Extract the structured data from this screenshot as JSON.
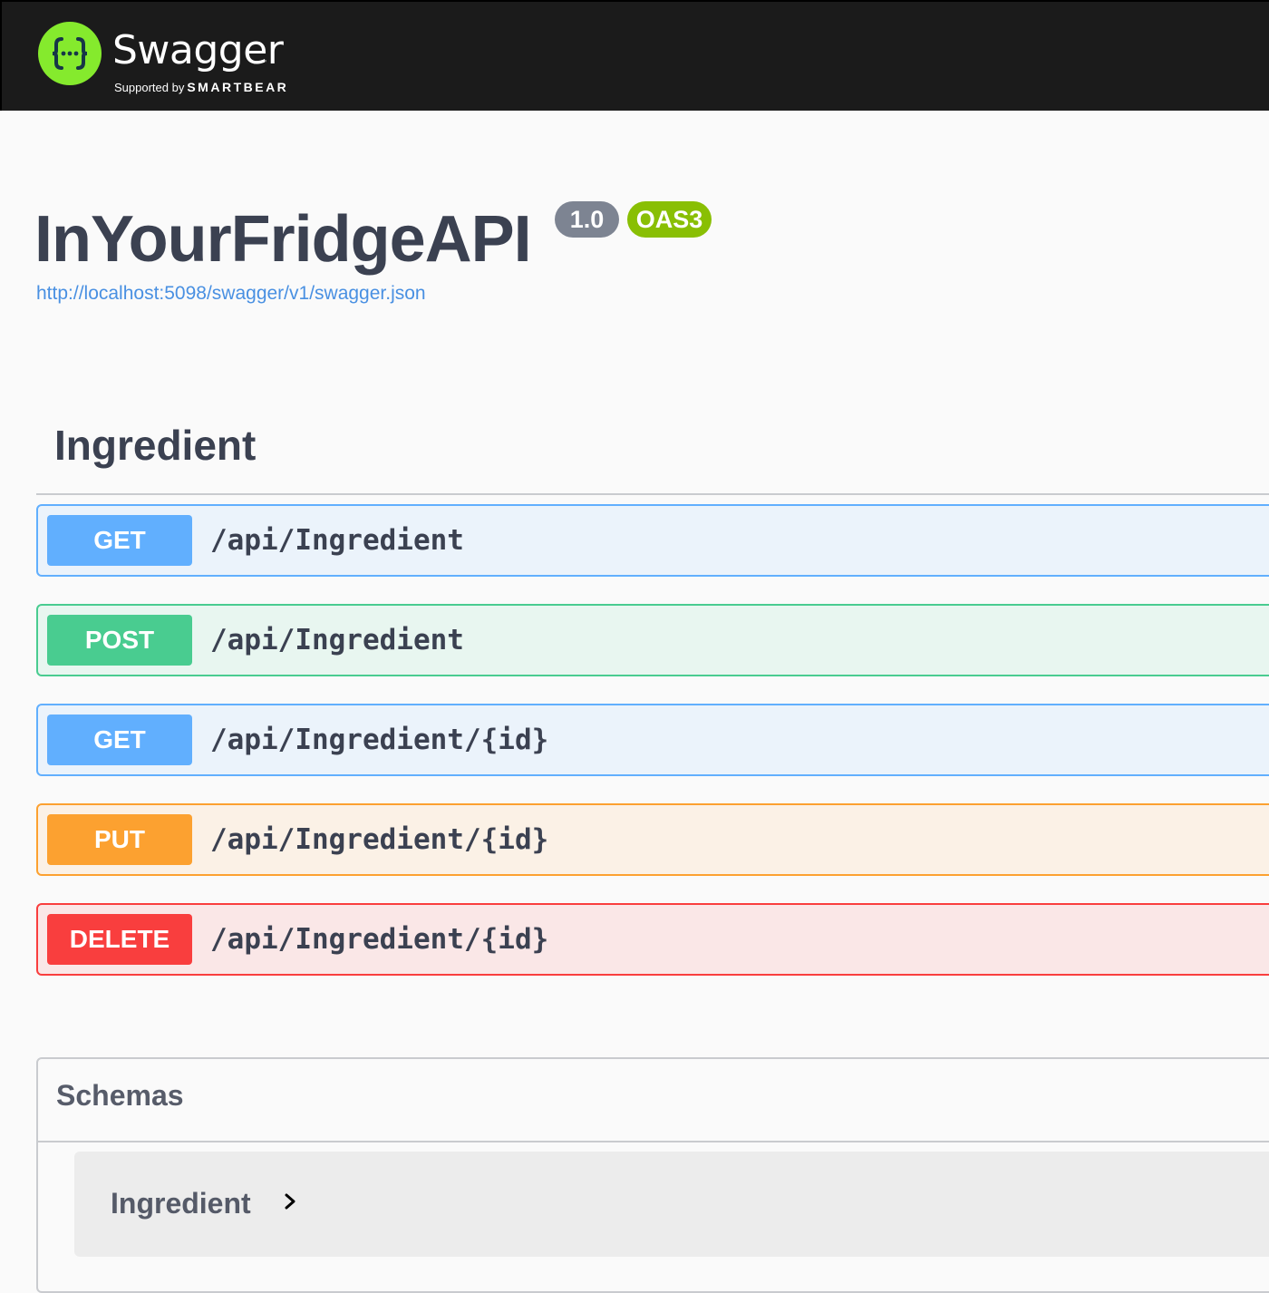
{
  "topbar": {
    "logo_title": "Swagger",
    "logo_tm": "™",
    "supported_by": "Supported by",
    "brand": "SMARTBEAR",
    "logo_icon": "swagger-braces-icon",
    "colors": {
      "background": "#1b1b1b",
      "logo_green": "#85ea2d"
    }
  },
  "info": {
    "title": "InYourFridgeAPI",
    "version": "1.0",
    "oas_badge": "OAS3",
    "spec_url": "http://localhost:5098/swagger/v1/swagger.json"
  },
  "tag": {
    "name": "Ingredient",
    "operations": [
      {
        "method": "GET",
        "path": "/api/Ingredient",
        "color": "#61affe"
      },
      {
        "method": "POST",
        "path": "/api/Ingredient",
        "color": "#49cc90"
      },
      {
        "method": "GET",
        "path": "/api/Ingredient/{id}",
        "color": "#61affe"
      },
      {
        "method": "PUT",
        "path": "/api/Ingredient/{id}",
        "color": "#fca130"
      },
      {
        "method": "DELETE",
        "path": "/api/Ingredient/{id}",
        "color": "#f93e3e"
      }
    ]
  },
  "schemas": {
    "title": "Schemas",
    "items": [
      {
        "name": "Ingredient",
        "icon": "chevron-right-icon"
      }
    ]
  }
}
